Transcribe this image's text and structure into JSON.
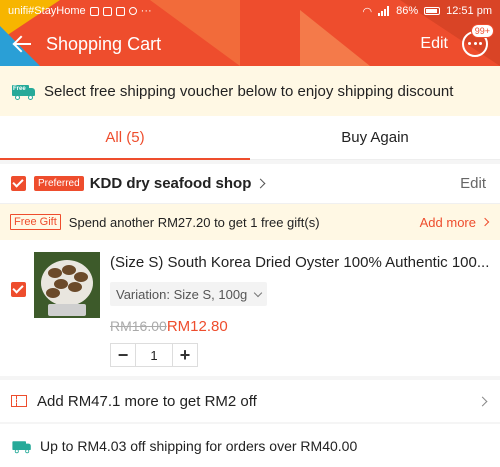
{
  "status_bar": {
    "carrier": "unifi#StayHome",
    "battery": "86%",
    "time": "12:51 pm"
  },
  "header": {
    "title": "Shopping Cart",
    "edit_label": "Edit",
    "chat_badge": "99+"
  },
  "free_shipping_banner": {
    "icon_tag": "Free",
    "text": "Select free shipping voucher below to enjoy shipping discount"
  },
  "tabs": [
    {
      "label": "All (5)",
      "active": true
    },
    {
      "label": "Buy Again",
      "active": false
    }
  ],
  "shop": {
    "badge": "Preferred",
    "name": "KDD dry seafood shop",
    "edit_label": "Edit",
    "gift": {
      "tag": "Free Gift",
      "text": "Spend another RM27.20 to get 1 free gift(s)",
      "action": "Add more"
    },
    "item": {
      "title": "(Size S) South Korea Dried Oyster 100% Authentic 100...",
      "variation": "Variation: Size S,  100g",
      "old_price": "RM16.00",
      "price": "RM12.80",
      "quantity": "1",
      "minus": "−",
      "plus": "+"
    }
  },
  "discount": {
    "text": "Add RM47.1 more to get RM2 off"
  },
  "shipping_offer": {
    "text": "Up to RM4.03 off shipping for orders over RM40.00"
  },
  "colors": {
    "brand": "#ee4d2d",
    "banner_bg": "#fff8e4",
    "shipping_green": "#26aa99"
  }
}
